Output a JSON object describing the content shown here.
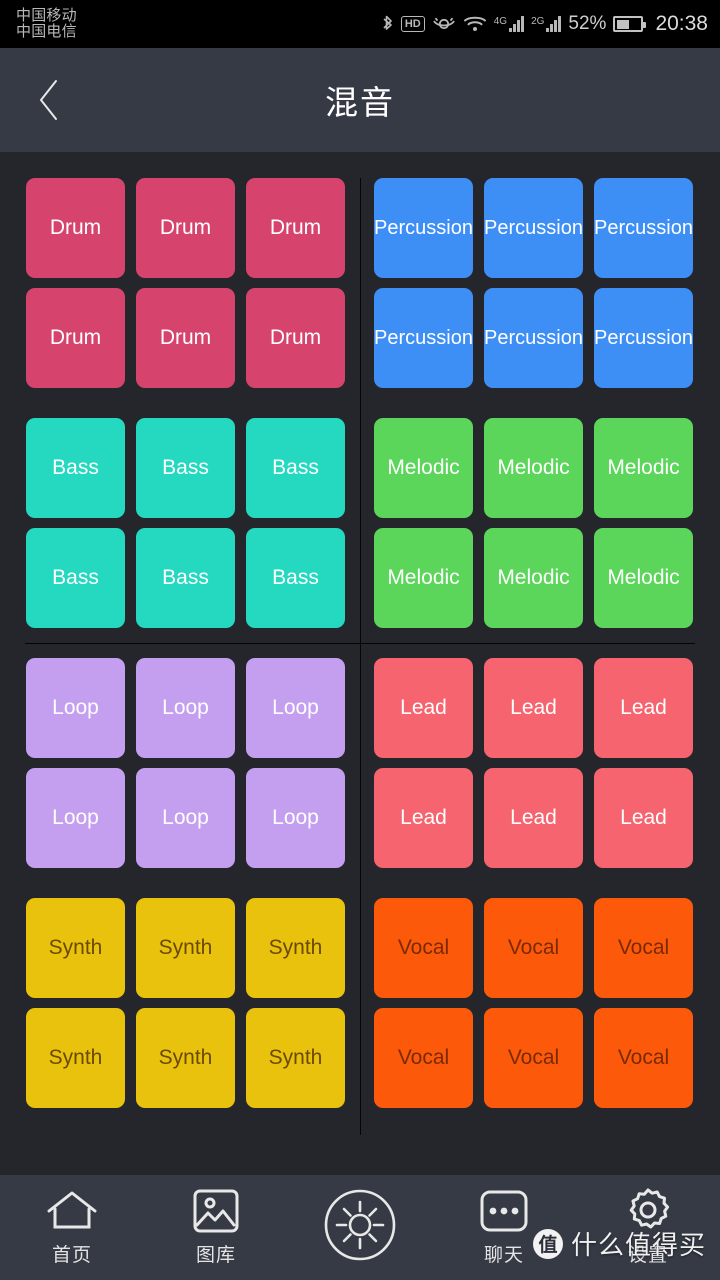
{
  "status_bar": {
    "carriers": [
      "中国移动",
      "中国电信"
    ],
    "icons": [
      "bluetooth-icon",
      "hd-icon",
      "eye-care-icon",
      "wifi-icon"
    ],
    "hd_label": "HD",
    "signal_4g_label": "4G",
    "signal_2g_label": "2G",
    "battery_percent": "52%",
    "clock": "20:38"
  },
  "header": {
    "back_icon": "chevron-left-icon",
    "title": "混音"
  },
  "board": {
    "sections": [
      {
        "left": {
          "label": "Drum",
          "color": "#d6446d",
          "text_color": "#ffffff",
          "rows": [
            [
              "Drum",
              "Drum",
              "Drum"
            ],
            [
              "Drum",
              "Drum",
              "Drum"
            ]
          ]
        },
        "right": {
          "label": "Percussion",
          "color": "#3d8ff5",
          "text_color": "#ffffff",
          "rows": [
            [
              "Percussion",
              "Percussion",
              "Percussion"
            ],
            [
              "Percussion",
              "Percussion",
              "Percussion"
            ]
          ]
        }
      },
      {
        "left": {
          "label": "Bass",
          "color": "#25d9c0",
          "text_color": "#ffffff",
          "rows": [
            [
              "Bass",
              "Bass",
              "Bass"
            ],
            [
              "Bass",
              "Bass",
              "Bass"
            ]
          ]
        },
        "right": {
          "label": "Melodic",
          "color": "#5bd65b",
          "text_color": "#ffffff",
          "rows": [
            [
              "Melodic",
              "Melodic",
              "Melodic"
            ],
            [
              "Melodic",
              "Melodic",
              "Melodic"
            ]
          ]
        }
      },
      {
        "left": {
          "label": "Loop",
          "color": "#c49ff0",
          "text_color": "#ffffff",
          "rows": [
            [
              "Loop",
              "Loop",
              "Loop"
            ],
            [
              "Loop",
              "Loop",
              "Loop"
            ]
          ]
        },
        "right": {
          "label": "Lead",
          "color": "#f5646f",
          "text_color": "#ffffff",
          "rows": [
            [
              "Lead",
              "Lead",
              "Lead"
            ],
            [
              "Lead",
              "Lead",
              "Lead"
            ]
          ]
        }
      },
      {
        "left": {
          "label": "Synth",
          "color": "#e8c20c",
          "text_color": "#6b4a00",
          "rows": [
            [
              "Synth",
              "Synth",
              "Synth"
            ],
            [
              "Synth",
              "Synth",
              "Synth"
            ]
          ]
        },
        "right": {
          "label": "Vocal",
          "color": "#fc5a0a",
          "text_color": "#7a2a00",
          "rows": [
            [
              "Vocal",
              "Vocal",
              "Vocal"
            ],
            [
              "Vocal",
              "Vocal",
              "Vocal"
            ]
          ]
        }
      }
    ]
  },
  "navbar": {
    "items": [
      {
        "icon": "home-icon",
        "label": "首页"
      },
      {
        "icon": "gallery-icon",
        "label": "图库"
      },
      {
        "icon": "sun-icon",
        "label": ""
      },
      {
        "icon": "chat-icon",
        "label": "聊天"
      },
      {
        "icon": "gear-icon",
        "label": "设置"
      }
    ]
  },
  "watermark": {
    "logo_char": "值",
    "text": "什么值得买"
  }
}
